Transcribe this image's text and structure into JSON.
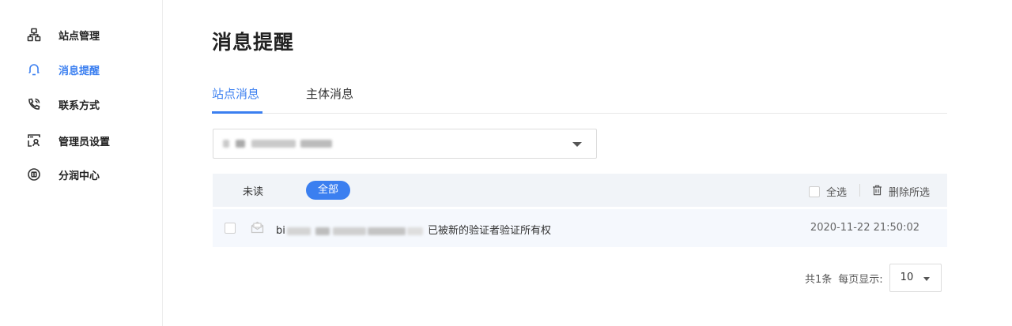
{
  "sidebar": {
    "items": [
      {
        "label": "站点管理",
        "icon": "sitemap-icon",
        "active": false
      },
      {
        "label": "消息提醒",
        "icon": "bell-icon",
        "active": true
      },
      {
        "label": "联系方式",
        "icon": "phone-icon",
        "active": false
      },
      {
        "label": "管理员设置",
        "icon": "admin-icon",
        "active": false
      },
      {
        "label": "分润中心",
        "icon": "profit-icon",
        "active": false
      }
    ]
  },
  "page": {
    "title": "消息提醒"
  },
  "tabs": [
    {
      "label": "站点消息",
      "active": true
    },
    {
      "label": "主体消息",
      "active": false
    }
  ],
  "site_select": {
    "selected_value": ""
  },
  "filter": {
    "unread_label": "未读",
    "all_label": "全部",
    "select_all_label": "全选",
    "delete_selected_label": "删除所选"
  },
  "messages": [
    {
      "sender_prefix": "bi",
      "text": "已被新的验证者验证所有权",
      "time": "2020-11-22 21:50:02",
      "read": true
    }
  ],
  "pagination": {
    "total_label": "共1条",
    "per_page_label": "每页显示:",
    "page_size": "10"
  },
  "colors": {
    "accent": "#3b7ff0",
    "filter_bar_bg": "#f1f4f8",
    "row_bg": "#f5f8fd"
  }
}
